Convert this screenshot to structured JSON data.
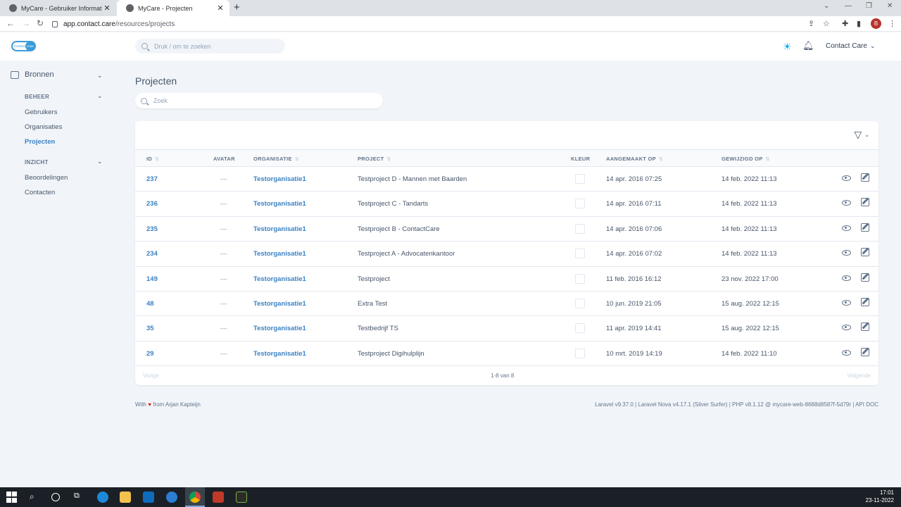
{
  "browser": {
    "tabs": [
      {
        "title": "MyCare - Gebruiker Informatie: C",
        "active": false
      },
      {
        "title": "MyCare - Projecten",
        "active": true
      }
    ],
    "url_host": "app.contact.care",
    "url_path": "/resources/projects",
    "profile_initial": "B"
  },
  "header": {
    "logo_left": "Contact",
    "logo_right": "Care",
    "search_placeholder": "Druk / om te zoeken",
    "user_name": "Contact Care"
  },
  "sidebar": {
    "section_title": "Bronnen",
    "groups": [
      {
        "title": "BEHEER",
        "items": [
          {
            "label": "Gebruikers",
            "active": false
          },
          {
            "label": "Organisaties",
            "active": false
          },
          {
            "label": "Projecten",
            "active": true
          }
        ]
      },
      {
        "title": "INZICHT",
        "items": [
          {
            "label": "Beoordelingen",
            "active": false
          },
          {
            "label": "Contacten",
            "active": false
          }
        ]
      }
    ]
  },
  "main": {
    "title": "Projecten",
    "search_placeholder": "Zoek",
    "columns": {
      "id": "ID",
      "avatar": "AVATAR",
      "organisation": "ORGANISATIE",
      "project": "PROJECT",
      "color": "KLEUR",
      "created": "AANGEMAAKT OP",
      "modified": "GEWIJZIGD OP"
    },
    "rows": [
      {
        "id": "237",
        "avatar": "—",
        "organisation": "Testorganisatie1",
        "project": "Testproject D - Mannen met Baarden",
        "created": "14 apr. 2016 07:25",
        "modified": "14 feb. 2022 11:13"
      },
      {
        "id": "236",
        "avatar": "—",
        "organisation": "Testorganisatie1",
        "project": "Testproject C - Tandarts",
        "created": "14 apr. 2016 07:11",
        "modified": "14 feb. 2022 11:13"
      },
      {
        "id": "235",
        "avatar": "—",
        "organisation": "Testorganisatie1",
        "project": "Testproject B - ContactCare",
        "created": "14 apr. 2016 07:06",
        "modified": "14 feb. 2022 11:13"
      },
      {
        "id": "234",
        "avatar": "—",
        "organisation": "Testorganisatie1",
        "project": "Testproject A - Advocatenkantoor",
        "created": "14 apr. 2016 07:02",
        "modified": "14 feb. 2022 11:13"
      },
      {
        "id": "149",
        "avatar": "—",
        "organisation": "Testorganisatie1",
        "project": "Testproject",
        "created": "11 feb. 2016 16:12",
        "modified": "23 nov. 2022 17:00"
      },
      {
        "id": "48",
        "avatar": "—",
        "organisation": "Testorganisatie1",
        "project": "Extra Test",
        "created": "10 jun. 2019 21:05",
        "modified": "15 aug. 2022 12:15"
      },
      {
        "id": "35",
        "avatar": "—",
        "organisation": "Testorganisatie1",
        "project": "Testbedrijf TS",
        "created": "11 apr. 2019 14:41",
        "modified": "15 aug. 2022 12:15"
      },
      {
        "id": "29",
        "avatar": "—",
        "organisation": "Testorganisatie1",
        "project": "Testproject Digihulplijn",
        "created": "10 mrt. 2019 14:19",
        "modified": "14 feb. 2022 11:10"
      }
    ],
    "pager": {
      "prev": "Vorige",
      "count": "1-8 van 8",
      "next": "Volgende"
    }
  },
  "footer": {
    "left_prefix": "With",
    "left_suffix": "from Arjan Kapteijn",
    "right": "Laravel v9.37.0 | Laravel Nova v4.17.1 (Silver Surfer) | PHP v8.1.12 @ mycare-web-8688d8587f-5d79r | API DOC"
  },
  "taskbar": {
    "time": "17:01",
    "date": "23-11-2022"
  },
  "colors": {
    "accent": "#3b82c4",
    "background": "#f1f5f9",
    "heart": "#dc2626"
  }
}
